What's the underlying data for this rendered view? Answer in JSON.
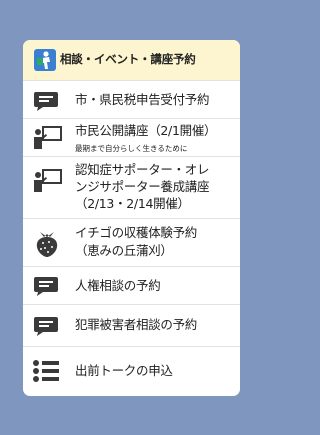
{
  "header": {
    "title": "相談・イベント・講座予約",
    "icon": "reservation-person-icon"
  },
  "items": [
    {
      "label": "市・県民税申告受付予約",
      "icon": "chat-bubble-icon"
    },
    {
      "label": "市民公開講座（2/1開催）",
      "sub": "最期まで自分らしく生きるために",
      "icon": "lecture-icon"
    },
    {
      "label_lines": [
        "認知症サポーター・オレ",
        "ンジサポーター養成講座",
        "（2/13・2/14開催）"
      ],
      "icon": "lecture-icon"
    },
    {
      "label_lines": [
        "イチゴの収穫体験予約",
        "（恵みの丘蒲刈）"
      ],
      "icon": "strawberry-icon"
    },
    {
      "label": "人権相談の予約",
      "icon": "chat-bubble-icon"
    },
    {
      "label": "犯罪被害者相談の予約",
      "icon": "chat-bubble-icon"
    },
    {
      "label": "出前トークの申込",
      "icon": "list-icon"
    }
  ],
  "colors": {
    "background": "#7f97bf",
    "header": "#fdf5cf",
    "icon": "#3a3a3a"
  }
}
